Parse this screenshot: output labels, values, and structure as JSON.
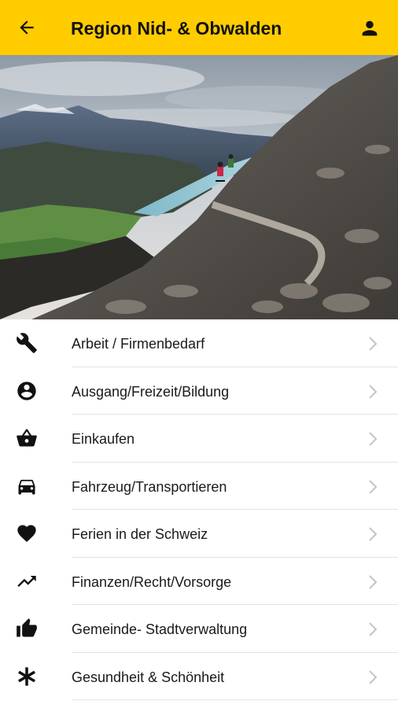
{
  "header": {
    "title": "Region Nid- & Obwalden",
    "back_icon": "arrow-left-icon",
    "account_icon": "person-icon",
    "background": "#FFCC00"
  },
  "hero": {
    "image": "mountain-bike-trail-photo"
  },
  "categories": [
    {
      "label": "Arbeit / Firmenbedarf",
      "icon": "tools-icon"
    },
    {
      "label": "Ausgang/Freizeit/Bildung",
      "icon": "account-circle-icon"
    },
    {
      "label": "Einkaufen",
      "icon": "shopping-basket-icon"
    },
    {
      "label": "Fahrzeug/Transportieren",
      "icon": "car-icon"
    },
    {
      "label": "Ferien in der Schweiz",
      "icon": "heart-icon"
    },
    {
      "label": "Finanzen/Recht/Vorsorge",
      "icon": "trending-up-icon"
    },
    {
      "label": "Gemeinde- Stadtverwaltung",
      "icon": "thumbs-up-icon"
    },
    {
      "label": "Gesundheit & Schönheit",
      "icon": "asterisk-icon"
    }
  ]
}
